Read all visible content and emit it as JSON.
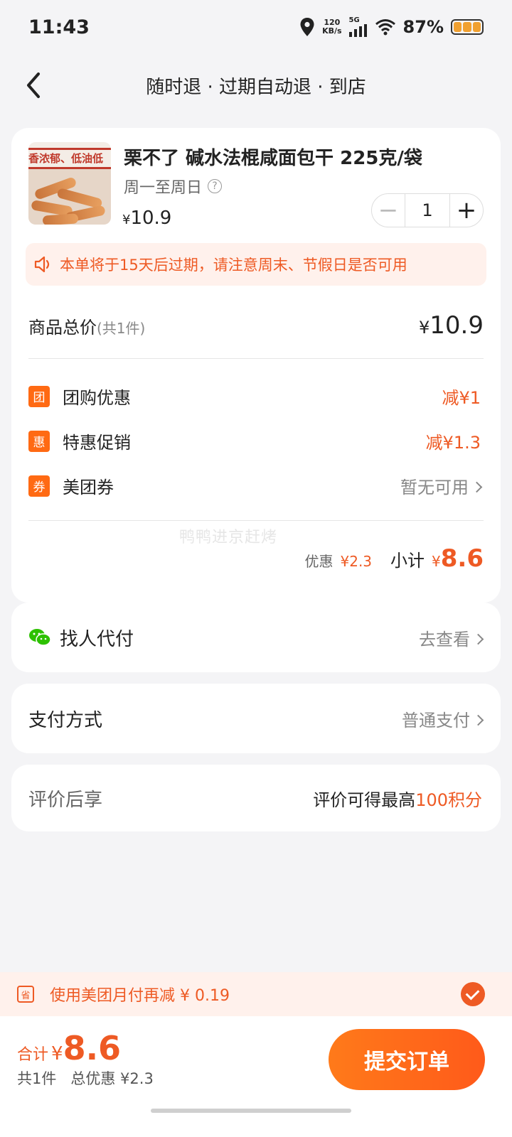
{
  "status": {
    "time": "11:43",
    "speed_value": "120",
    "speed_unit": "KB/s",
    "network": "5G",
    "battery": "87%"
  },
  "nav": {
    "title": "随时退 · 过期自动退 · 到店"
  },
  "product": {
    "thumb_text": "香浓郁、低油低",
    "name": "栗不了 碱水法棍咸面包干 225克/袋",
    "days": "周一至周日",
    "price_symbol": "¥",
    "price": "10.9",
    "quantity": "1",
    "notice": "本单将于15天后过期，请注意周末、节假日是否可用"
  },
  "summary": {
    "total_label": "商品总价",
    "total_count": "(共1件)",
    "total_value": "10.9",
    "currency": "¥",
    "discounts": [
      {
        "badge": "团",
        "label": "团购优惠",
        "value": "减¥1"
      },
      {
        "badge": "惠",
        "label": "特惠促销",
        "value": "减¥1.3"
      },
      {
        "badge": "券",
        "label": "美团券",
        "value": "暂无可用"
      }
    ],
    "watermark": "鸭鸭进京赶烤",
    "discount_label": "优惠",
    "discount_value": "¥2.3",
    "subtotal_label": "小计",
    "subtotal_value": "8.6"
  },
  "pay_for_me": {
    "label": "找人代付",
    "action": "去查看"
  },
  "payment": {
    "label": "支付方式",
    "value": "普通支付"
  },
  "review": {
    "label": "评价后享",
    "text": "评价可得最高",
    "highlight": "100积分"
  },
  "promo": {
    "icon": "省",
    "text": "使用美团月付再减 ¥ 0.19"
  },
  "footer": {
    "sum_label": "合计",
    "sum_yen": "¥",
    "sum_value": "8.6",
    "count": "共1件",
    "total_discount": "总优惠 ¥2.3",
    "submit": "提交订单"
  },
  "colors": {
    "accent": "#ee5a24",
    "button": "#ff6a13",
    "background": "#f4f4f6"
  }
}
